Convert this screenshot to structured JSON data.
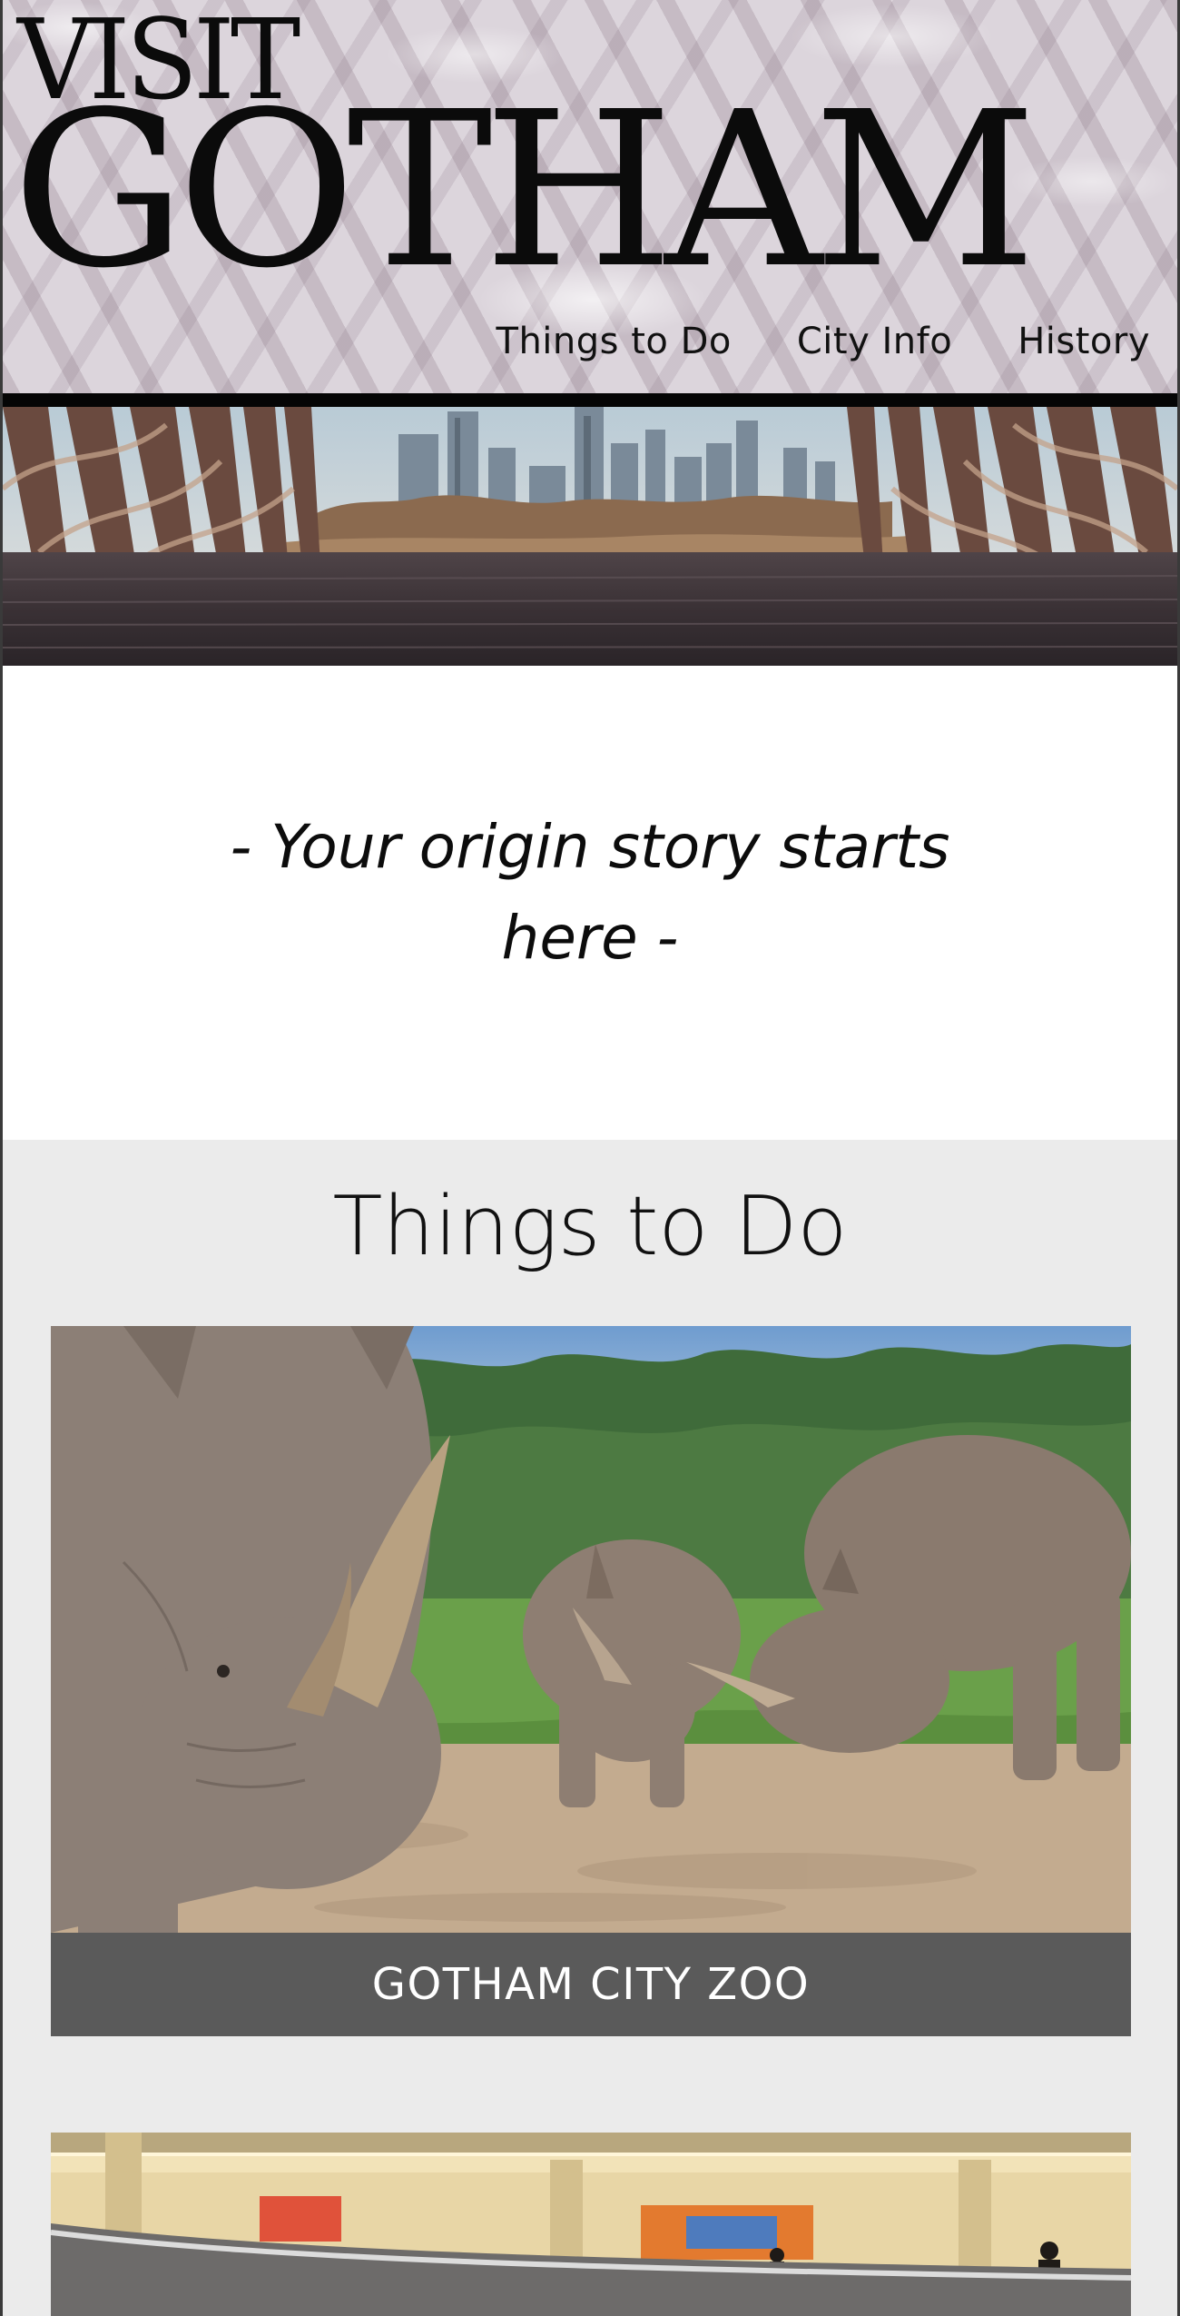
{
  "header": {
    "logo_line1": "VISIT",
    "logo_line2": "GOTHAM",
    "nav": [
      {
        "label": "Things to Do"
      },
      {
        "label": "City Info"
      },
      {
        "label": "History"
      }
    ]
  },
  "hero": {
    "image": "city-skyline-boardwalk-image"
  },
  "tagline": {
    "text": "- Your origin story starts here -"
  },
  "things_to_do": {
    "title": "Things to Do",
    "cards": [
      {
        "caption": "GOTHAM CITY ZOO",
        "image": "rhinos-image"
      },
      {
        "caption": "",
        "image": "museum-gallery-image"
      }
    ]
  },
  "colors": {
    "header_bg": "#dcd5dc",
    "header_rule": "#050505",
    "section_bg": "#ebebeb",
    "caption_bg": "#5a5a5a",
    "text": "#111111"
  }
}
